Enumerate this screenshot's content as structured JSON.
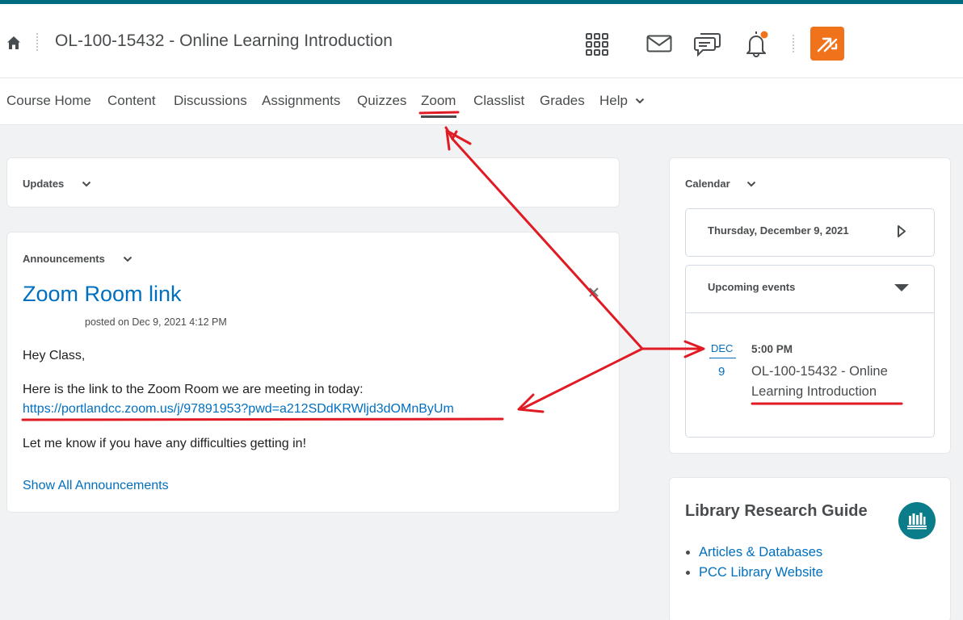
{
  "header": {
    "course_title": "OL-100-15432 - Online Learning Introduction",
    "icons": [
      "home-icon",
      "waffle-grid-icon",
      "mail-icon",
      "chat-icon",
      "bell-icon",
      "orange-switch-icon"
    ],
    "accent_color": "#006b7e",
    "orange_color": "#f0731c",
    "notification_dot_color": "#f0731c"
  },
  "nav": {
    "items": [
      "Course Home",
      "Content",
      "Discussions",
      "Assignments",
      "Quizzes",
      "Zoom",
      "Classlist",
      "Grades",
      "Help"
    ],
    "active": "Zoom"
  },
  "updates": {
    "title": "Updates"
  },
  "announcements": {
    "title": "Announcements",
    "item_title": "Zoom Room link",
    "posted": "posted on Dec 9, 2021 4:12 PM",
    "greeting": "Hey Class,",
    "intro": "Here is the link to the Zoom Room we are meeting in today:",
    "link": "https://portlandcc.zoom.us/j/97891953?pwd=a212SDdKRWljd3dOMnByUm",
    "closing": "Let me know if you have any difficulties getting in!",
    "show_all": "Show All Announcements"
  },
  "calendar": {
    "title": "Calendar",
    "date": "Thursday, December 9, 2021",
    "upcoming_title": "Upcoming events",
    "event": {
      "month": "DEC",
      "day": "9",
      "time": "5:00 PM",
      "title": "OL-100-15432  - Online Learning Introduction"
    }
  },
  "library": {
    "title": "Library Research Guide",
    "links": [
      "Articles & Databases",
      "PCC Library Website"
    ]
  },
  "annotation_color": "#e01b24"
}
